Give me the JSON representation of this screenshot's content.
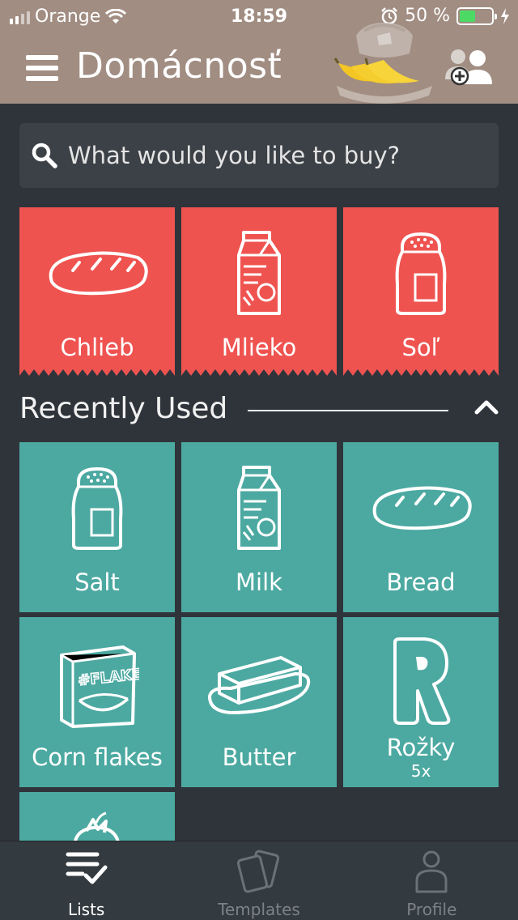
{
  "status_bar": {
    "carrier": "Orange",
    "time": "18:59",
    "battery": "50 %",
    "battery_level": 0.5
  },
  "header": {
    "title": "Domácnosť"
  },
  "search": {
    "placeholder": "What would you like to buy?"
  },
  "current_items": [
    {
      "label": "Chlieb",
      "icon": "bread-icon"
    },
    {
      "label": "Mlieko",
      "icon": "milk-carton-icon"
    },
    {
      "label": "Soľ",
      "icon": "salt-shaker-icon"
    }
  ],
  "recently_used": {
    "title": "Recently Used",
    "items": [
      {
        "label": "Salt",
        "icon": "salt-shaker-icon"
      },
      {
        "label": "Milk",
        "icon": "milk-carton-icon"
      },
      {
        "label": "Bread",
        "icon": "bread-icon"
      },
      {
        "label": "Corn flakes",
        "icon": "cereal-box-icon"
      },
      {
        "label": "Butter",
        "icon": "butter-icon"
      },
      {
        "label": "Rožky",
        "quantity": "5x",
        "icon": "letter-r-icon"
      },
      {
        "label": "",
        "icon": "tomato-icon"
      }
    ]
  },
  "tabs": [
    {
      "label": "Lists",
      "active": true,
      "icon": "list-check-icon"
    },
    {
      "label": "Templates",
      "active": false,
      "icon": "cards-icon"
    },
    {
      "label": "Profile",
      "active": false,
      "icon": "person-icon"
    }
  ],
  "colors": {
    "header": "#a18d82",
    "background": "#2f343b",
    "current_tile": "#ef5350",
    "recent_tile": "#4ca9a1",
    "battery_fill": "#4cd964"
  }
}
